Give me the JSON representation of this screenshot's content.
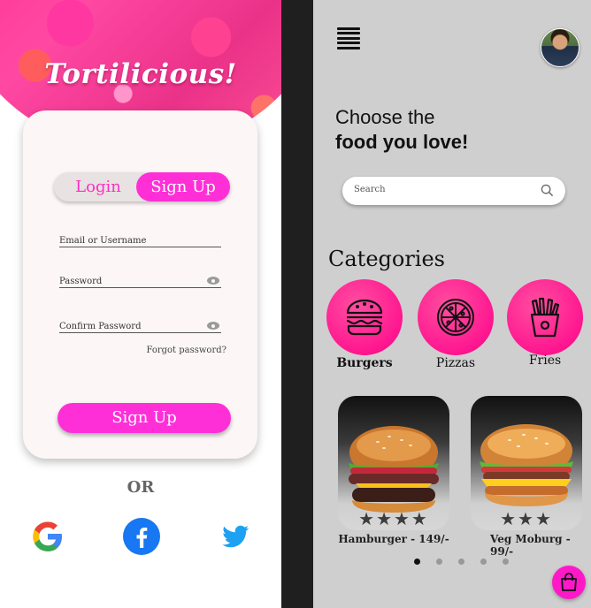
{
  "login_screen": {
    "app_title": "Tortilicious!",
    "tabs": [
      {
        "label": "Login",
        "active": false
      },
      {
        "label": "Sign Up",
        "active": true
      }
    ],
    "fields": {
      "email_label": "Email or Username",
      "password_label": "Password",
      "confirm_label": "Confirm Password"
    },
    "forgot_password": "Forgot password?",
    "signup_button": "Sign Up",
    "or_text": "OR",
    "social_icons": [
      "google-icon",
      "facebook-icon",
      "twitter-icon"
    ],
    "accent_color": "#ff2fd8"
  },
  "food_screen": {
    "heading_line1": "Choose the",
    "heading_line2": "food you love!",
    "search_placeholder": "Search",
    "categories_title": "Categories",
    "categories": [
      {
        "label": "Burgers",
        "icon": "burger-icon"
      },
      {
        "label": "Pizzas",
        "icon": "pizza-icon"
      },
      {
        "label": "Fries",
        "icon": "fries-icon"
      }
    ],
    "items": [
      {
        "label": "Hamburger - 149/-",
        "rating": 4
      },
      {
        "label": "Veg Moburg - 99/-",
        "rating": 3
      }
    ],
    "carousel": {
      "pages": 5,
      "active": 1
    },
    "accent_color": "#ff18c8"
  }
}
